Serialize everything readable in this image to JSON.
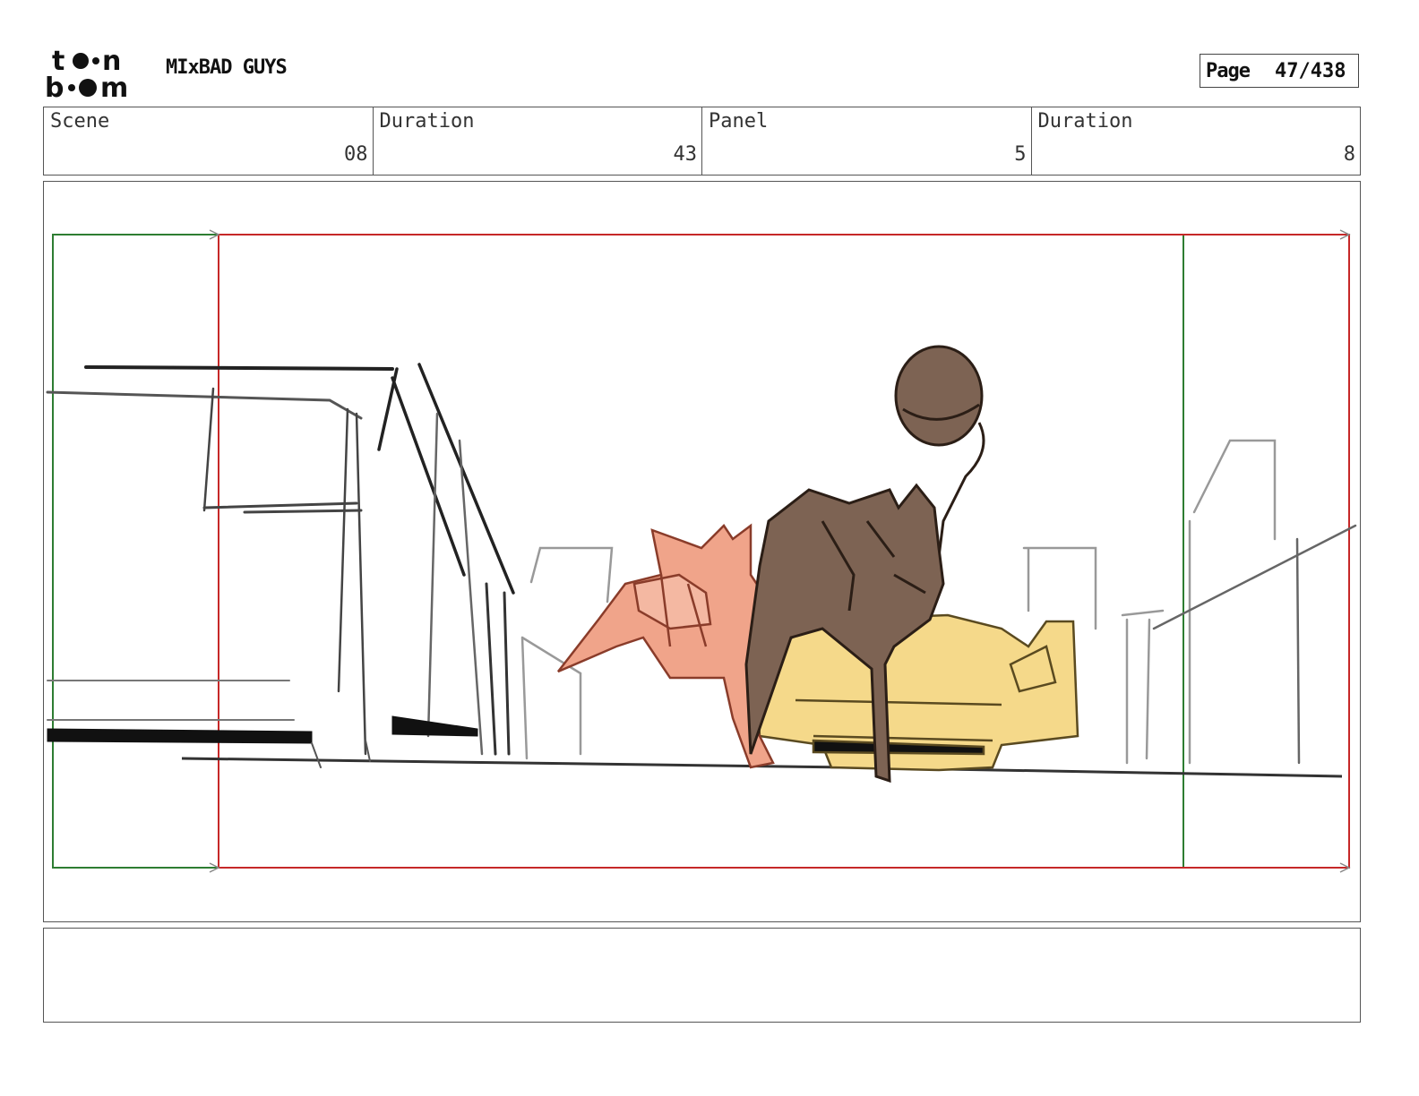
{
  "header": {
    "logo_text": "toon boom",
    "project_title": "MIxBAD GUYS",
    "page_label": "Page",
    "page_number": "47/438"
  },
  "info": [
    {
      "label": "Scene",
      "value": "08"
    },
    {
      "label": "Duration",
      "value": "43"
    },
    {
      "label": "Panel",
      "value": "5"
    },
    {
      "label": "Duration",
      "value": "8"
    }
  ],
  "colors": {
    "frame_green": "#2e7d32",
    "frame_red": "#c62828",
    "character_brown": "#7d6353",
    "character_salmon": "#f0a48a",
    "car_yellow": "#f5d98a"
  },
  "notes": ""
}
